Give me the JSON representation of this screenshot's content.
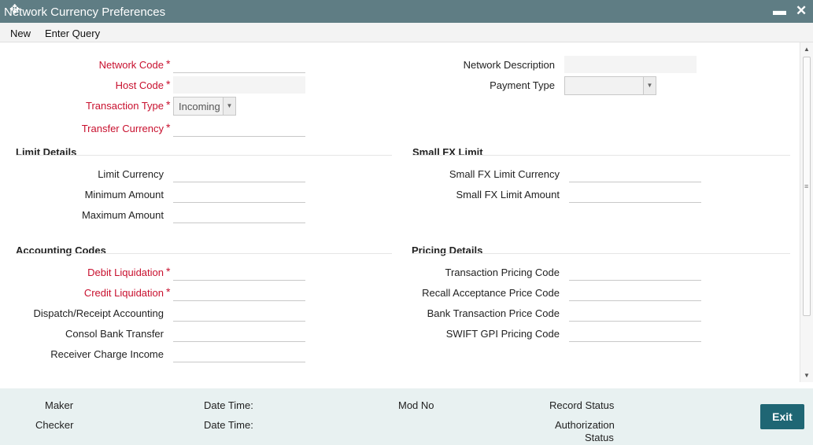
{
  "window": {
    "title": "Network Currency Preferences",
    "minimize_glyph": "▬",
    "close_glyph": "✕"
  },
  "menu": {
    "new_label": "New",
    "enter_query_label": "Enter Query"
  },
  "header_fields": {
    "network_code": {
      "label": "Network Code",
      "value": "",
      "required": true
    },
    "host_code": {
      "label": "Host Code",
      "value": "",
      "required": true
    },
    "transaction_type": {
      "label": "Transaction Type",
      "value": "Incoming",
      "required": true
    },
    "transfer_currency": {
      "label": "Transfer Currency",
      "value": "",
      "required": true
    },
    "network_description": {
      "label": "Network Description",
      "value": ""
    },
    "payment_type": {
      "label": "Payment Type",
      "value": ""
    }
  },
  "limit_details": {
    "title": "Limit Details",
    "limit_currency": "Limit Currency",
    "minimum_amount": "Minimum Amount",
    "maximum_amount": "Maximum Amount"
  },
  "small_fx_limit": {
    "title": "Small FX Limit",
    "currency": "Small FX Limit Currency",
    "amount": "Small FX Limit Amount"
  },
  "accounting_codes": {
    "title": "Accounting Codes",
    "debit_liquidation": "Debit Liquidation",
    "credit_liquidation": "Credit Liquidation",
    "dispatch_receipt": "Dispatch/Receipt Accounting",
    "consol_bank_transfer": "Consol Bank Transfer",
    "receiver_charge_income": "Receiver Charge Income"
  },
  "pricing_details": {
    "title": "Pricing Details",
    "transaction_pricing_code": "Transaction Pricing Code",
    "recall_acceptance_price_code": "Recall Acceptance Price Code",
    "bank_transaction_price_code": "Bank Transaction Price Code",
    "swift_gpi_pricing_code": "SWIFT GPI Pricing Code"
  },
  "footer": {
    "maker": "Maker",
    "checker": "Checker",
    "date_time_1": "Date Time:",
    "date_time_2": "Date Time:",
    "mod_no": "Mod No",
    "record_status": "Record Status",
    "authorization_status_line1": "Authorization",
    "authorization_status_line2": "Status",
    "exit_label": "Exit"
  },
  "icons": {
    "required_marker": "*",
    "dropdown": "chevron-down-icon",
    "cursor": "move-cursor-icon"
  },
  "colors": {
    "titlebar": "#5f7d84",
    "required": "#c8102e",
    "footer": "#e8f1f1",
    "exit_button": "#1f6674"
  }
}
